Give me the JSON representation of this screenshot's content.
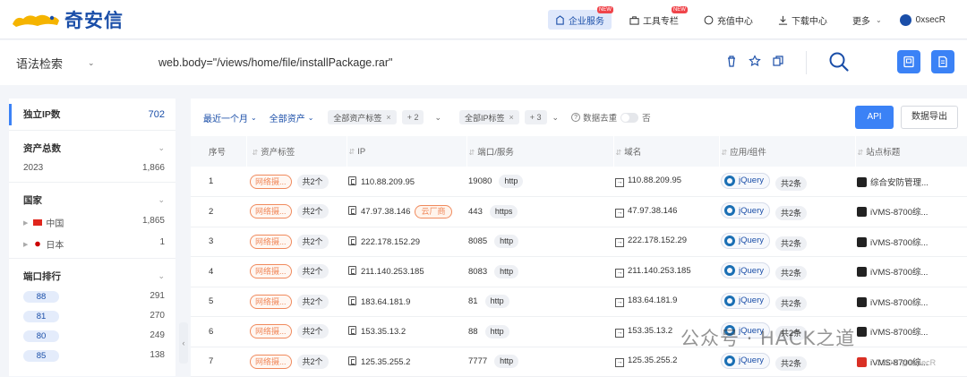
{
  "brand": {
    "name": "奇安信"
  },
  "nav": {
    "items": [
      {
        "label": "企业服务",
        "badge": "NEW",
        "icon": "building-icon"
      },
      {
        "label": "工具专栏",
        "badge": "NEW",
        "icon": "toolbox-icon"
      },
      {
        "label": "充值中心",
        "icon": "coin-icon"
      },
      {
        "label": "下载中心",
        "icon": "download-icon"
      },
      {
        "label": "更多",
        "icon": "chevron-down-icon"
      }
    ],
    "user": "0xsecR"
  },
  "search": {
    "mode": "语法检索",
    "query": "web.body=\"/views/home/file/installPackage.rar\""
  },
  "sidebar": {
    "ip_label": "独立IP数",
    "ip_value": "702",
    "assets_label": "资产总数",
    "assets_year": "2023",
    "assets_value": "1,866",
    "country_label": "国家",
    "countries": [
      {
        "name": "中国",
        "value": "1,865"
      },
      {
        "name": "日本",
        "value": "1"
      }
    ],
    "port_label": "端口排行",
    "ports": [
      {
        "port": "88",
        "value": "291"
      },
      {
        "port": "81",
        "value": "270"
      },
      {
        "port": "80",
        "value": "249"
      },
      {
        "port": "85",
        "value": "138"
      }
    ]
  },
  "filters": {
    "time": "最近一个月",
    "assets": "全部资产",
    "asset_tags": "全部资产标签",
    "asset_tags_more": "+ 2",
    "ip_tags": "全部IP标签",
    "ip_tags_more": "+ 3",
    "dedup": "数据去重",
    "dedup_state": "否",
    "api": "API",
    "export": "数据导出"
  },
  "table": {
    "headers": [
      "序号",
      "资产标签",
      "IP",
      "端口/服务",
      "域名",
      "应用/组件",
      "站点标题"
    ],
    "rows": [
      {
        "no": "1",
        "tag": "网络摄...",
        "count": "共2个",
        "ip": "110.88.209.95",
        "cloud": "",
        "port": "19080",
        "svc": "http",
        "domain": "110.88.209.95",
        "app": "jQuery",
        "apps": "共2条",
        "title": "综合安防管理..."
      },
      {
        "no": "2",
        "tag": "网络摄...",
        "count": "共2个",
        "ip": "47.97.38.146",
        "cloud": "云厂商",
        "port": "443",
        "svc": "https",
        "domain": "47.97.38.146",
        "app": "jQuery",
        "apps": "共2条",
        "title": "iVMS-8700综..."
      },
      {
        "no": "3",
        "tag": "网络摄...",
        "count": "共2个",
        "ip": "222.178.152.29",
        "cloud": "",
        "port": "8085",
        "svc": "http",
        "domain": "222.178.152.29",
        "app": "jQuery",
        "apps": "共2条",
        "title": "iVMS-8700综..."
      },
      {
        "no": "4",
        "tag": "网络摄...",
        "count": "共2个",
        "ip": "211.140.253.185",
        "cloud": "",
        "port": "8083",
        "svc": "http",
        "domain": "211.140.253.185",
        "app": "jQuery",
        "apps": "共2条",
        "title": "iVMS-8700综..."
      },
      {
        "no": "5",
        "tag": "网络摄...",
        "count": "共2个",
        "ip": "183.64.181.9",
        "cloud": "",
        "port": "81",
        "svc": "http",
        "domain": "183.64.181.9",
        "app": "jQuery",
        "apps": "共2条",
        "title": "iVMS-8700综..."
      },
      {
        "no": "6",
        "tag": "网络摄...",
        "count": "共2个",
        "ip": "153.35.13.2",
        "cloud": "",
        "port": "88",
        "svc": "http",
        "domain": "153.35.13.2",
        "app": "jQuery",
        "apps": "共2条",
        "title": "iVMS-8700综..."
      },
      {
        "no": "7",
        "tag": "网络摄...",
        "count": "共2个",
        "ip": "125.35.255.2",
        "cloud": "",
        "port": "7777",
        "svc": "http",
        "domain": "125.35.255.2",
        "app": "jQuery",
        "apps": "共2条",
        "title": "iVMS-8700综..."
      }
    ]
  },
  "watermark": {
    "text": "公众号 · HACK之道",
    "small": "CSDN @0xsecR"
  }
}
